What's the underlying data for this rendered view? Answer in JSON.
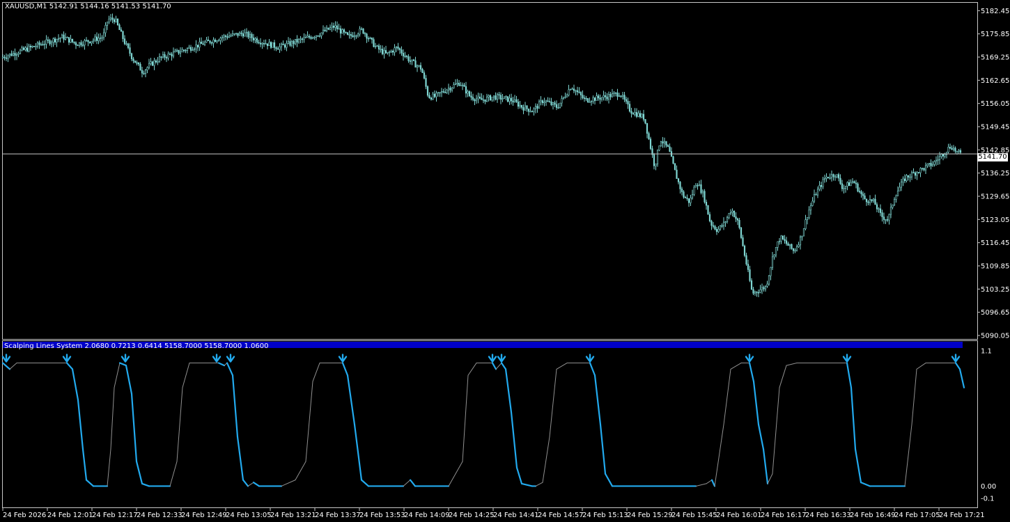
{
  "main_title": "XAUUSD,M1  5142.91 5144.16 5141.53 5141.70",
  "indicator_title": "Scalping Lines System 2.0680 0.7213 0.6414 5158.7000 5158.7000 1.0600",
  "current_price": "5141.70",
  "colors": {
    "background": "#000000",
    "frame": "#c8c8c8",
    "candle": "#7fd6d2",
    "indicator": "#22aaee",
    "indicator_thin": "#909090",
    "indicator_bar": "#0000c8"
  },
  "chart_data": [
    {
      "type": "candlestick",
      "symbol": "XAUUSD,M1",
      "ylim": [
        5090.05,
        5184.3
      ],
      "y_ticks": [
        "5182.45",
        "5175.85",
        "5169.25",
        "5162.65",
        "5156.05",
        "5149.45",
        "5142.85",
        "5136.25",
        "5129.65",
        "5123.05",
        "5116.45",
        "5109.85",
        "5103.25",
        "5096.65",
        "5090.05"
      ],
      "current_price": 5141.7,
      "close_path": [
        [
          0,
          5169
        ],
        [
          30,
          5171
        ],
        [
          60,
          5173
        ],
        [
          90,
          5175
        ],
        [
          110,
          5173
        ],
        [
          130,
          5174
        ],
        [
          148,
          5175
        ],
        [
          155,
          5180
        ],
        [
          165,
          5180
        ],
        [
          180,
          5173
        ],
        [
          190,
          5169
        ],
        [
          205,
          5165
        ],
        [
          215,
          5167
        ],
        [
          230,
          5169
        ],
        [
          260,
          5171
        ],
        [
          290,
          5173
        ],
        [
          320,
          5175
        ],
        [
          350,
          5176
        ],
        [
          370,
          5174
        ],
        [
          400,
          5172
        ],
        [
          430,
          5174
        ],
        [
          460,
          5176
        ],
        [
          480,
          5178
        ],
        [
          500,
          5175
        ],
        [
          520,
          5177
        ],
        [
          540,
          5172
        ],
        [
          555,
          5170
        ],
        [
          570,
          5172
        ],
        [
          590,
          5168
        ],
        [
          605,
          5166
        ],
        [
          615,
          5158
        ],
        [
          625,
          5158
        ],
        [
          640,
          5160
        ],
        [
          660,
          5162
        ],
        [
          675,
          5158
        ],
        [
          690,
          5157
        ],
        [
          710,
          5158
        ],
        [
          735,
          5157
        ],
        [
          750,
          5155
        ],
        [
          765,
          5154
        ],
        [
          780,
          5157
        ],
        [
          800,
          5155
        ],
        [
          820,
          5161
        ],
        [
          840,
          5157
        ],
        [
          870,
          5158
        ],
        [
          890,
          5159
        ],
        [
          905,
          5154
        ],
        [
          925,
          5152
        ],
        [
          940,
          5138
        ],
        [
          948,
          5146
        ],
        [
          960,
          5143
        ],
        [
          970,
          5136
        ],
        [
          980,
          5130
        ],
        [
          990,
          5128
        ],
        [
          1000,
          5134
        ],
        [
          1010,
          5130
        ],
        [
          1020,
          5122
        ],
        [
          1030,
          5120
        ],
        [
          1040,
          5122
        ],
        [
          1050,
          5126
        ],
        [
          1060,
          5122
        ],
        [
          1070,
          5112
        ],
        [
          1080,
          5102
        ],
        [
          1090,
          5103
        ],
        [
          1100,
          5104
        ],
        [
          1110,
          5113
        ],
        [
          1120,
          5118
        ],
        [
          1130,
          5116
        ],
        [
          1140,
          5114
        ],
        [
          1150,
          5118
        ],
        [
          1160,
          5125
        ],
        [
          1170,
          5130
        ],
        [
          1185,
          5135
        ],
        [
          1200,
          5136
        ],
        [
          1210,
          5132
        ],
        [
          1225,
          5134
        ],
        [
          1240,
          5129
        ],
        [
          1255,
          5128
        ],
        [
          1265,
          5124
        ],
        [
          1275,
          5123
        ],
        [
          1285,
          5130
        ],
        [
          1300,
          5135
        ],
        [
          1320,
          5137
        ],
        [
          1340,
          5139
        ],
        [
          1355,
          5142
        ],
        [
          1365,
          5144
        ],
        [
          1375,
          5142
        ],
        [
          1380,
          5141.7
        ]
      ]
    },
    {
      "type": "line",
      "name": "Scalping Lines System",
      "ylim": [
        -0.15,
        1.15
      ],
      "y_ticks": [
        "1.1",
        "0.00",
        "-0.1"
      ],
      "series": [
        {
          "values_path": [
            [
              0,
              1.0
            ],
            [
              10,
              0.95
            ],
            [
              20,
              1.0
            ],
            [
              40,
              1.0
            ],
            [
              92,
              1.0
            ],
            [
              100,
              0.95
            ],
            [
              108,
              0.7
            ],
            [
              115,
              0.3
            ],
            [
              120,
              0.05
            ],
            [
              130,
              0.0
            ],
            [
              150,
              0.0
            ],
            [
              155,
              0.3
            ],
            [
              160,
              0.8
            ],
            [
              168,
              1.0
            ],
            [
              177,
              0.98
            ],
            [
              185,
              0.75
            ],
            [
              192,
              0.2
            ],
            [
              200,
              0.02
            ],
            [
              210,
              0.0
            ],
            [
              240,
              0.0
            ],
            [
              250,
              0.2
            ],
            [
              258,
              0.8
            ],
            [
              268,
              1.0
            ],
            [
              300,
              1.0
            ],
            [
              310,
              1.0
            ],
            [
              318,
              0.98
            ],
            [
              322,
              1.0
            ],
            [
              330,
              0.9
            ],
            [
              337,
              0.4
            ],
            [
              345,
              0.05
            ],
            [
              352,
              0.0
            ],
            [
              360,
              0.03
            ],
            [
              368,
              0.0
            ],
            [
              400,
              0.0
            ],
            [
              420,
              0.05
            ],
            [
              435,
              0.2
            ],
            [
              445,
              0.85
            ],
            [
              455,
              1.0
            ],
            [
              488,
              1.0
            ],
            [
              495,
              0.9
            ],
            [
              505,
              0.5
            ],
            [
              515,
              0.05
            ],
            [
              525,
              0.0
            ],
            [
              575,
              0.0
            ],
            [
              585,
              0.05
            ],
            [
              592,
              0.0
            ],
            [
              640,
              0.0
            ],
            [
              660,
              0.2
            ],
            [
              668,
              0.9
            ],
            [
              680,
              1.0
            ],
            [
              703,
              1.0
            ],
            [
              708,
              0.95
            ],
            [
              716,
              1.0
            ],
            [
              722,
              0.95
            ],
            [
              730,
              0.6
            ],
            [
              738,
              0.15
            ],
            [
              745,
              0.02
            ],
            [
              760,
              0.0
            ],
            [
              765,
              0.0
            ],
            [
              775,
              0.03
            ],
            [
              785,
              0.4
            ],
            [
              795,
              0.95
            ],
            [
              810,
              1.0
            ],
            [
              843,
              1.0
            ],
            [
              850,
              0.9
            ],
            [
              858,
              0.5
            ],
            [
              865,
              0.1
            ],
            [
              875,
              0.0
            ],
            [
              995,
              0.0
            ],
            [
              1010,
              0.02
            ],
            [
              1018,
              0.05
            ],
            [
              1022,
              0.0
            ],
            [
              1035,
              0.5
            ],
            [
              1045,
              0.95
            ],
            [
              1060,
              1.0
            ],
            [
              1072,
              1.0
            ],
            [
              1078,
              0.85
            ],
            [
              1085,
              0.5
            ],
            [
              1092,
              0.3
            ],
            [
              1098,
              0.02
            ],
            [
              1105,
              0.1
            ],
            [
              1115,
              0.8
            ],
            [
              1125,
              0.98
            ],
            [
              1140,
              1.0
            ],
            [
              1212,
              1.0
            ],
            [
              1218,
              0.8
            ],
            [
              1224,
              0.3
            ],
            [
              1232,
              0.03
            ],
            [
              1245,
              0.0
            ],
            [
              1295,
              0.0
            ],
            [
              1305,
              0.5
            ],
            [
              1312,
              0.95
            ],
            [
              1325,
              1.0
            ],
            [
              1368,
              1.0
            ],
            [
              1374,
              0.95
            ],
            [
              1380,
              0.8
            ]
          ]
        }
      ],
      "signals": [
        5,
        92,
        176,
        307,
        327,
        488,
        703,
        716,
        843,
        1072,
        1212,
        1368
      ]
    }
  ],
  "x_axis": {
    "tick_labels": [
      "24 Feb 2026",
      "24 Feb 12:01",
      "24 Feb 12:17",
      "24 Feb 12:33",
      "24 Feb 12:49",
      "24 Feb 13:05",
      "24 Feb 13:21",
      "24 Feb 13:37",
      "24 Feb 13:53",
      "24 Feb 14:09",
      "24 Feb 14:25",
      "24 Feb 14:41",
      "24 Feb 14:57",
      "24 Feb 15:13",
      "24 Feb 15:29",
      "24 Feb 15:45",
      "24 Feb 16:01",
      "24 Feb 16:17",
      "24 Feb 16:33",
      "24 Feb 16:49",
      "24 Feb 17:05",
      "24 Feb 17:21"
    ]
  }
}
